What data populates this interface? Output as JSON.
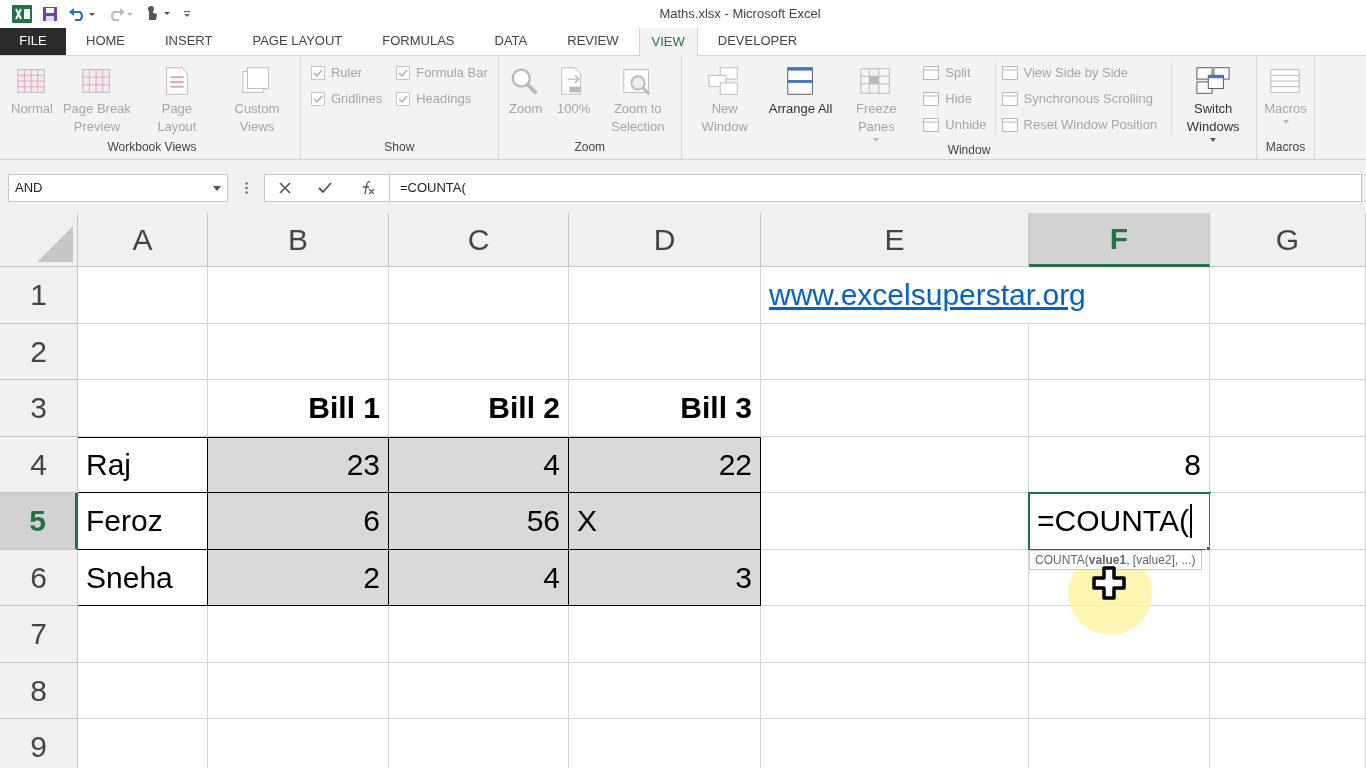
{
  "window": {
    "title": "Maths.xlsx - Microsoft Excel"
  },
  "tabs": [
    {
      "label": "FILE",
      "kind": "file",
      "selected": false
    },
    {
      "label": "HOME",
      "kind": "tab",
      "selected": false
    },
    {
      "label": "INSERT",
      "kind": "tab",
      "selected": false
    },
    {
      "label": "PAGE LAYOUT",
      "kind": "tab",
      "selected": false
    },
    {
      "label": "FORMULAS",
      "kind": "tab",
      "selected": false
    },
    {
      "label": "DATA",
      "kind": "tab",
      "selected": false
    },
    {
      "label": "REVIEW",
      "kind": "tab",
      "selected": false
    },
    {
      "label": "VIEW",
      "kind": "tab",
      "selected": true
    },
    {
      "label": "DEVELOPER",
      "kind": "tab",
      "selected": false
    }
  ],
  "ribbon": {
    "groups": [
      {
        "label": "Workbook Views",
        "items": [
          {
            "kind": "large",
            "label": "Normal",
            "disabled": true
          },
          {
            "kind": "large",
            "label": "Page Break Preview",
            "disabled": true
          },
          {
            "kind": "large",
            "label": "Page Layout",
            "disabled": true
          },
          {
            "kind": "large",
            "label": "Custom Views",
            "disabled": true
          }
        ]
      },
      {
        "label": "Show",
        "items": [
          {
            "kind": "stack",
            "items": [
              {
                "kind": "check",
                "label": "Ruler",
                "checked": true,
                "disabled": true
              },
              {
                "kind": "check",
                "label": "Gridlines",
                "checked": true,
                "disabled": true
              }
            ]
          },
          {
            "kind": "stack",
            "items": [
              {
                "kind": "check",
                "label": "Formula Bar",
                "checked": true,
                "disabled": true
              },
              {
                "kind": "check",
                "label": "Headings",
                "checked": true,
                "disabled": true
              }
            ]
          }
        ]
      },
      {
        "label": "Zoom",
        "items": [
          {
            "kind": "large",
            "label": "Zoom",
            "disabled": true
          },
          {
            "kind": "large",
            "label": "100%",
            "disabled": true
          },
          {
            "kind": "large",
            "label": "Zoom to Selection",
            "disabled": true
          }
        ]
      },
      {
        "label": "Window",
        "items": [
          {
            "kind": "large",
            "label": "New Window",
            "disabled": true
          },
          {
            "kind": "large",
            "label": "Arrange All",
            "disabled": false
          },
          {
            "kind": "large",
            "label": "Freeze Panes",
            "disabled": true,
            "dropdown": true
          },
          {
            "kind": "stack",
            "items": [
              {
                "kind": "small",
                "label": "Split",
                "disabled": true
              },
              {
                "kind": "small",
                "label": "Hide",
                "disabled": true
              },
              {
                "kind": "small",
                "label": "Unhide",
                "disabled": true
              }
            ]
          },
          {
            "kind": "stack",
            "items": [
              {
                "kind": "small",
                "label": "View Side by Side",
                "disabled": true
              },
              {
                "kind": "small",
                "label": "Synchronous Scrolling",
                "disabled": true
              },
              {
                "kind": "small",
                "label": "Reset Window Position",
                "disabled": true
              }
            ]
          },
          {
            "kind": "large",
            "label": "Switch Windows",
            "disabled": false,
            "dropdown": true
          }
        ]
      },
      {
        "label": "Macros",
        "items": [
          {
            "kind": "large",
            "label": "Macros",
            "disabled": true,
            "dropdown": true
          }
        ]
      }
    ]
  },
  "formula_bar": {
    "name_box": "AND",
    "formula": "=COUNTA("
  },
  "sheet": {
    "columns": [
      {
        "label": "A",
        "selected": false
      },
      {
        "label": "B",
        "selected": false
      },
      {
        "label": "C",
        "selected": false
      },
      {
        "label": "D",
        "selected": false
      },
      {
        "label": "E",
        "selected": false
      },
      {
        "label": "F",
        "selected": true
      },
      {
        "label": "G",
        "selected": false
      }
    ],
    "rows": [
      {
        "header": "1",
        "selected": false,
        "cells": [
          {},
          {},
          {},
          {},
          {
            "text": "www.excelsuperstar.org",
            "kind": "link"
          },
          {},
          {}
        ]
      },
      {
        "header": "2",
        "selected": false,
        "cells": [
          {},
          {},
          {},
          {},
          {},
          {},
          {}
        ]
      },
      {
        "header": "3",
        "selected": false,
        "cells": [
          {},
          {
            "text": "Bill 1",
            "kind": "bold"
          },
          {
            "text": "Bill 2",
            "kind": "bold"
          },
          {
            "text": "Bill 3",
            "kind": "bold"
          },
          {},
          {},
          {}
        ]
      },
      {
        "header": "4",
        "selected": false,
        "cells": [
          {
            "text": "Raj",
            "kind": "text",
            "boxed": true,
            "shaded": false
          },
          {
            "text": "23",
            "kind": "number",
            "boxed": true,
            "shaded": true
          },
          {
            "text": "4",
            "kind": "number",
            "boxed": true,
            "shaded": true
          },
          {
            "text": "22",
            "kind": "number",
            "boxed": true,
            "shaded": true
          },
          {},
          {
            "text": "8",
            "kind": "number"
          },
          {}
        ]
      },
      {
        "header": "5",
        "selected": true,
        "cells": [
          {
            "text": "Feroz",
            "kind": "text",
            "boxed": true,
            "shaded": false
          },
          {
            "text": "6",
            "kind": "number",
            "boxed": true,
            "shaded": true
          },
          {
            "text": "56",
            "kind": "number",
            "boxed": true,
            "shaded": true
          },
          {
            "text": "X",
            "kind": "text",
            "boxed": true,
            "shaded": true
          },
          {},
          {
            "text": "=COUNTA(",
            "kind": "editing"
          },
          {}
        ]
      },
      {
        "header": "6",
        "selected": false,
        "cells": [
          {
            "text": "Sneha",
            "kind": "text",
            "boxed": true,
            "shaded": false
          },
          {
            "text": "2",
            "kind": "number",
            "boxed": true,
            "shaded": true
          },
          {
            "text": "4",
            "kind": "number",
            "boxed": true,
            "shaded": true
          },
          {
            "text": "3",
            "kind": "number",
            "boxed": true,
            "shaded": true
          },
          {},
          {},
          {}
        ]
      },
      {
        "header": "7",
        "selected": false,
        "cells": [
          {},
          {},
          {},
          {},
          {},
          {},
          {}
        ]
      },
      {
        "header": "8",
        "selected": false,
        "cells": [
          {},
          {},
          {},
          {},
          {},
          {},
          {}
        ]
      },
      {
        "header": "9",
        "selected": false,
        "cells": [
          {},
          {},
          {},
          {},
          {},
          {},
          {}
        ]
      }
    ]
  },
  "tooltip": "COUNTA(**value1**, [value2], ...)"
}
